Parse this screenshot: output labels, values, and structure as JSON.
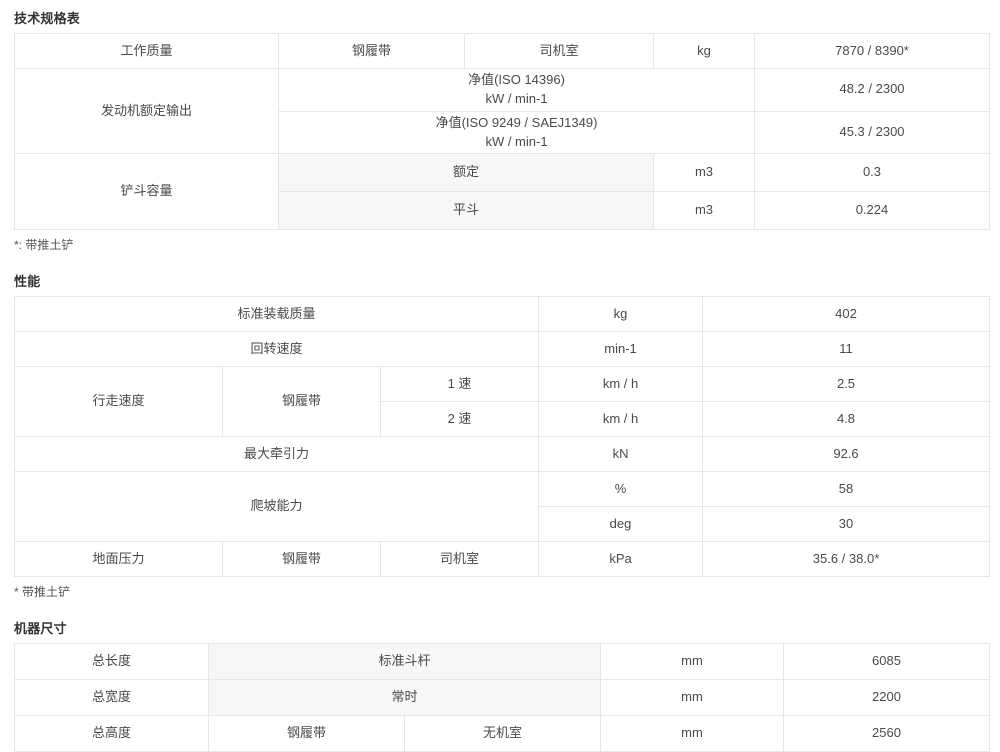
{
  "sections": [
    {
      "title": "技术规格表",
      "footnote": "*: 带推土铲",
      "rows": [
        {
          "label": "工作质量",
          "sub1": "钢履带",
          "sub2": "司机室",
          "unit": "kg",
          "value": "7870 / 8390*"
        },
        {
          "label": "发动机额定输出",
          "sub1": "净值(ISO 14396)\nkW / min-1",
          "unit": "",
          "value": "48.2 / 2300"
        },
        {
          "label": "",
          "sub1": "净值(ISO 9249 / SAEJ1349)\nkW / min-1",
          "unit": "",
          "value": "45.3 / 2300"
        },
        {
          "label": "铲斗容量",
          "sub1": "额定",
          "unit": "m3",
          "value": "0.3"
        },
        {
          "label": "",
          "sub1": "平斗",
          "unit": "m3",
          "value": "0.224"
        }
      ]
    },
    {
      "title": "性能",
      "footnote": "* 带推土铲",
      "rows": [
        {
          "label": "标准装载质量",
          "sub1": "",
          "sub2": "",
          "unit": "kg",
          "value": "402"
        },
        {
          "label": "回转速度",
          "sub1": "",
          "sub2": "",
          "unit": "min-1",
          "value": "11"
        },
        {
          "label": "行走速度",
          "sub1": "钢履带",
          "sub2": "1 速",
          "unit": "km / h",
          "value": "2.5"
        },
        {
          "label": "",
          "sub1": "",
          "sub2": "2 速",
          "unit": "km / h",
          "value": "4.8"
        },
        {
          "label": "最大牵引力",
          "sub1": "",
          "sub2": "",
          "unit": "kN",
          "value": "92.6"
        },
        {
          "label": "爬坡能力",
          "sub1": "",
          "sub2": "",
          "unit": "%",
          "value": "58"
        },
        {
          "label": "",
          "sub1": "",
          "sub2": "",
          "unit": "deg",
          "value": "30"
        },
        {
          "label": "地面压力",
          "sub1": "钢履带",
          "sub2": "司机室",
          "unit": "kPa",
          "value": "35.6 / 38.0*"
        }
      ]
    },
    {
      "title": "机器尺寸",
      "footnote": "",
      "rows": [
        {
          "label": "总长度",
          "sub1": "标准斗杆",
          "sub2": "",
          "unit": "mm",
          "value": "6085",
          "bold": true
        },
        {
          "label": "总宽度",
          "sub1": "常时",
          "sub2": "",
          "unit": "mm",
          "value": "2200",
          "bold": true
        },
        {
          "label": "总高度",
          "sub1": "钢履带",
          "sub2": "无机室",
          "unit": "mm",
          "value": "2560",
          "bold": false
        }
      ]
    }
  ],
  "colors": {
    "text": "#4a4a4a",
    "heading": "#333333",
    "border": "#e6e6e6",
    "shade": "#f7f7f7",
    "background": "#ffffff"
  }
}
